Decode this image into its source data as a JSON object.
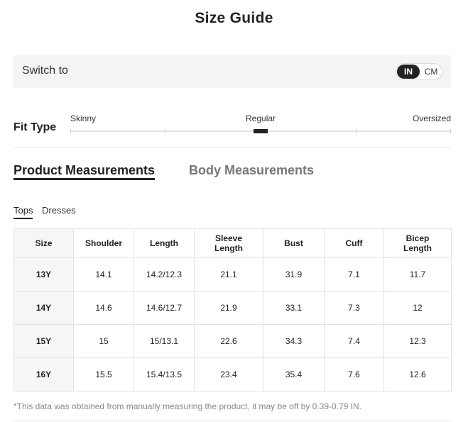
{
  "title": "Size Guide",
  "switch": {
    "label": "Switch to",
    "options": [
      "IN",
      "CM"
    ],
    "selected": "IN"
  },
  "fit": {
    "label": "Fit Type",
    "options": [
      "Skinny",
      "Regular",
      "Oversized"
    ],
    "selected": "Regular"
  },
  "tabs": {
    "product": "Product Measurements",
    "body": "Body Measurements",
    "active": "Product Measurements"
  },
  "subtabs": {
    "tops": "Tops",
    "dresses": "Dresses",
    "active": "Tops"
  },
  "table": {
    "headers": [
      "Size",
      "Shoulder",
      "Length",
      "Sleeve Length",
      "Bust",
      "Cuff",
      "Bicep Length"
    ],
    "rows": [
      [
        "13Y",
        "14.1",
        "14.2/12.3",
        "21.1",
        "31.9",
        "7.1",
        "11.7"
      ],
      [
        "14Y",
        "14.6",
        "14.6/12.7",
        "21.9",
        "33.1",
        "7.3",
        "12"
      ],
      [
        "15Y",
        "15",
        "15/13.1",
        "22.6",
        "34.3",
        "7.4",
        "12.3"
      ],
      [
        "16Y",
        "15.5",
        "15.4/13.5",
        "23.4",
        "35.4",
        "7.6",
        "12.6"
      ]
    ]
  },
  "note": "*This data was obtained from manually measuring the product, it may be off by 0.39-0.79 IN."
}
